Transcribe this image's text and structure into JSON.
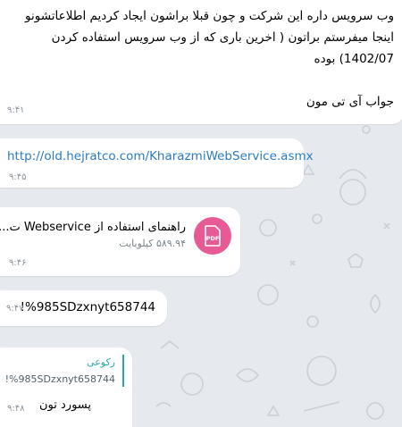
{
  "colors": {
    "background": "#e6e9ed",
    "bubble": "#ffffff",
    "link": "#2b7cc1",
    "pdf_icon": "#e85a96",
    "reply_accent": "#2ea6a6",
    "time": "#8a949c"
  },
  "messages": [
    {
      "type": "text",
      "lines": [
        "وب سرویس داره این شرکت و چون قبلا براشون ایجاد کردیم اطلاعاتشونو",
        "اینجا میفرستم براتون ( اخرین باری که از وب سرویس استفاده کردن",
        "1402/07) بوده",
        "",
        "جواب آی تی مون"
      ],
      "time": "۹:۴۱"
    },
    {
      "type": "link",
      "text": "http://old.hejratco.com/KharazmiWebService.asmx",
      "time": "۹:۴۵"
    },
    {
      "type": "file",
      "icon": "pdf-file-icon",
      "icon_label": "PDF",
      "file_name": "راهنمای استفاده از Webservice ت...",
      "file_size": "۵۸۹.۹۴ کیلوبایت",
      "time": "۹:۴۶"
    },
    {
      "type": "text",
      "text": "!%985SDzxnyt658744",
      "time": "۹:۴۷"
    },
    {
      "type": "reply",
      "reply_to_name": "رکوعی",
      "reply_to_text": "!%985SDzxnyt658744",
      "text": "پسورد تون",
      "time": "۹:۴۸"
    }
  ]
}
